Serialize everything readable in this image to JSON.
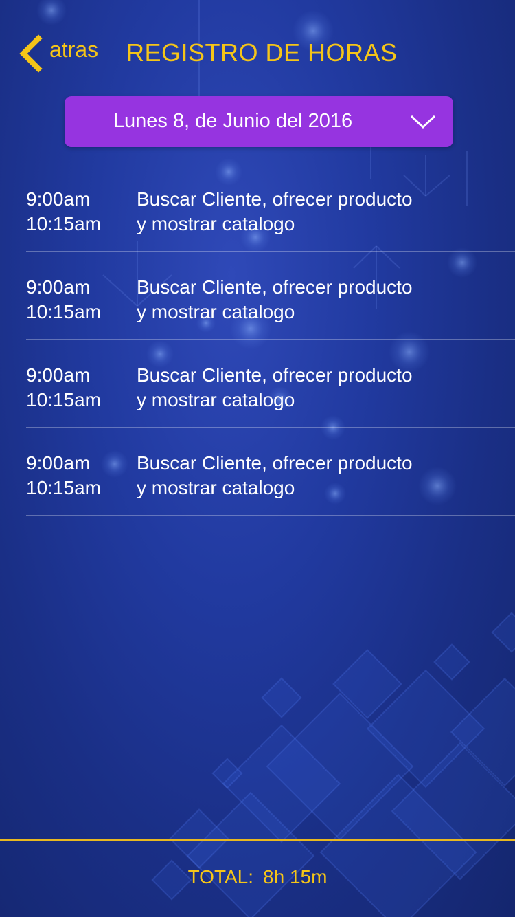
{
  "header": {
    "back_label": "atras",
    "title": "REGISTRO DE HORAS",
    "back_icon": "chevron-left-icon"
  },
  "date_selector": {
    "value": "Lunes 8, de Junio del 2016",
    "icon": "chevron-down-icon"
  },
  "entries": [
    {
      "start": "9:00am",
      "end": "10:15am",
      "desc_line1": "Buscar Cliente, ofrecer producto",
      "desc_line2": "y mostrar catalogo"
    },
    {
      "start": "9:00am",
      "end": "10:15am",
      "desc_line1": "Buscar Cliente, ofrecer producto",
      "desc_line2": "y mostrar catalogo"
    },
    {
      "start": "9:00am",
      "end": "10:15am",
      "desc_line1": "Buscar Cliente, ofrecer producto",
      "desc_line2": "y mostrar catalogo"
    },
    {
      "start": "9:00am",
      "end": "10:15am",
      "desc_line1": "Buscar Cliente, ofrecer producto",
      "desc_line2": "y mostrar catalogo"
    }
  ],
  "footer": {
    "total_label": "TOTAL:",
    "total_value": "8h 15m"
  },
  "colors": {
    "accent": "#f5c518",
    "dropdown_bg": "#9634e0",
    "background": "#213aa0"
  }
}
